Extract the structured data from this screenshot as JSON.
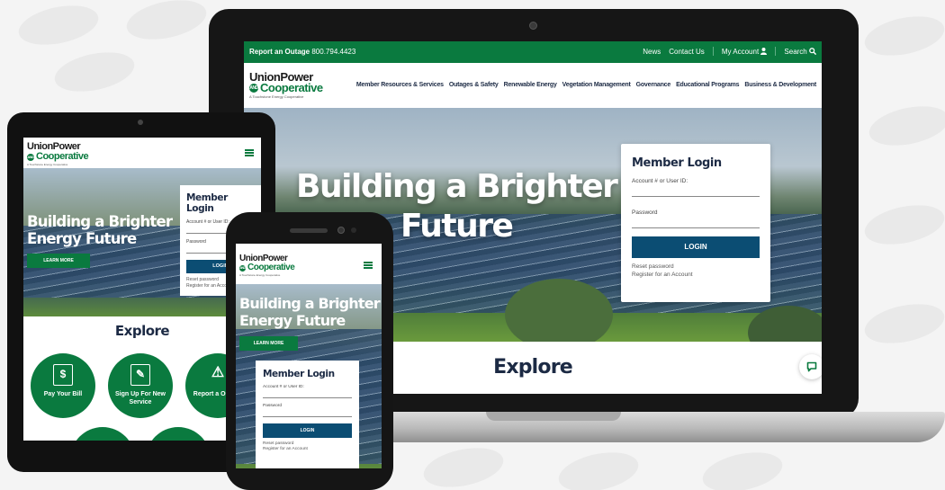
{
  "site": {
    "logo_line1": "UnionPower",
    "logo_line2": "Cooperative",
    "logo_and": "AND",
    "logo_tagline": "A Touchstone Energy Cooperative"
  },
  "topbar": {
    "outage_label": "Report an Outage",
    "outage_phone": "800.794.4423",
    "links": [
      "News",
      "Contact Us",
      "My Account",
      "Search"
    ]
  },
  "nav": {
    "items": [
      "Member Resources & Services",
      "Outages & Safety",
      "Renewable Energy",
      "Vegetation Management",
      "Governance",
      "Educational Programs",
      "Business & Development"
    ]
  },
  "hero": {
    "title_line1": "Building a Brighter",
    "title_line2": "Energy Future",
    "laptop_line2": "Future",
    "learn_more": "LEARN MORE"
  },
  "login": {
    "title": "Member Login",
    "account_label": "Account # or User ID:",
    "password_label": "Password",
    "button": "LOGIN",
    "reset": "Reset password",
    "register": "Register for an Account",
    "tablet_reset": "Reset password",
    "tablet_register": "Register for an Acco"
  },
  "explore": {
    "title": "Explore",
    "items": [
      "Pay Your Bill",
      "Sign Up For New Service",
      "Report a Outage"
    ]
  },
  "icons": {
    "search": "magnifier",
    "account": "person",
    "chat": "speech-bubble"
  },
  "colors": {
    "brand_green": "#0a7a3f",
    "navy": "#1c2a44",
    "login_blue": "#0b4d73"
  }
}
